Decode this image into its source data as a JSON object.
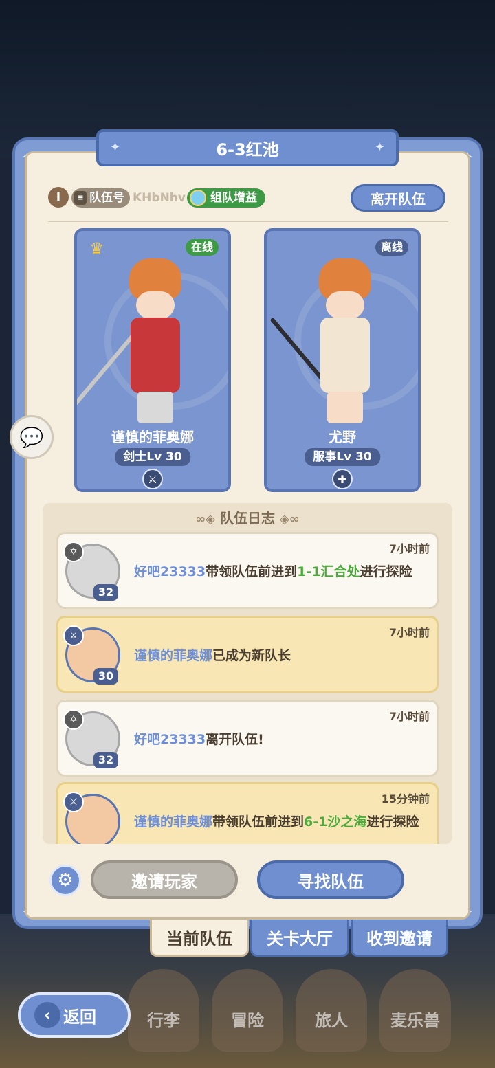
{
  "title": "6-3红池",
  "top_row": {
    "info_icon": "i",
    "team_id_label": "队伍号",
    "team_id_value": "KHbNhv",
    "buff_label": "组队增益",
    "leave_button": "离开队伍"
  },
  "members": [
    {
      "status": "在线",
      "name": "谨慎的菲奥娜",
      "class_level": "剑士Lv 30",
      "role_icon": "sword-icon",
      "leader": true
    },
    {
      "status": "离线",
      "name": "尤野",
      "class_level": "服事Lv 30",
      "role_icon": "cross-icon",
      "leader": false
    }
  ],
  "log": {
    "title": "队伍日志",
    "entries": [
      {
        "time": "7小时前",
        "who": "好吧23333",
        "text": "带领队伍前进到",
        "place": "1-1汇合处",
        "tail": "进行探险",
        "level": "32",
        "style": "white"
      },
      {
        "time": "7小时前",
        "who": "谨慎的菲奥娜",
        "text": "已成为新队长",
        "place": "",
        "tail": "",
        "level": "30",
        "style": "gold"
      },
      {
        "time": "7小时前",
        "who": "好吧23333",
        "text": "离开队伍!",
        "place": "",
        "tail": "",
        "level": "32",
        "style": "white"
      },
      {
        "time": "15分钟前",
        "who": "谨慎的菲奥娜",
        "text": "带领队伍前进到",
        "place": "6-1沙之海",
        "tail": "进行探险",
        "level": "",
        "style": "gold"
      }
    ]
  },
  "buttons": {
    "invite": "邀请玩家",
    "find": "寻找队伍"
  },
  "tabs": [
    "当前队伍",
    "关卡大厅",
    "收到邀请"
  ],
  "nav": {
    "back": "返回",
    "items": [
      "行李",
      "冒险",
      "旅人",
      "麦乐兽"
    ]
  }
}
